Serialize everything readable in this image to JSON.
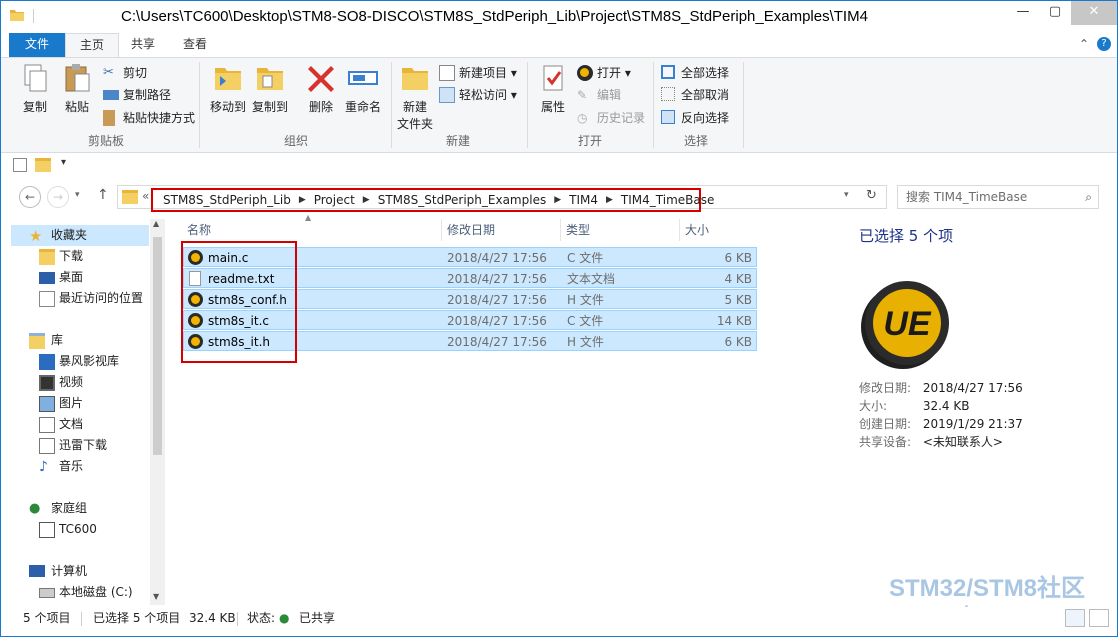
{
  "window": {
    "title": "C:\\Users\\TC600\\Desktop\\STM8-SO8-DISCO\\STM8S_StdPeriph_Lib\\Project\\STM8S_StdPeriph_Examples\\TIM4"
  },
  "ribbon_tabs": [
    "文件",
    "主页",
    "共享",
    "查看"
  ],
  "ribbon": {
    "clipboard": {
      "copy": "复制",
      "paste": "粘贴",
      "cut": "剪切",
      "copy_path": "复制路径",
      "paste_shortcut": "粘贴快捷方式",
      "label": "剪贴板"
    },
    "organize": {
      "move_to": "移动到",
      "copy_to": "复制到",
      "delete": "删除",
      "rename": "重命名",
      "label": "组织"
    },
    "new": {
      "new_folder_line1": "新建",
      "new_folder_line2": "文件夹",
      "new_item": "新建项目",
      "easy_access": "轻松访问",
      "label": "新建"
    },
    "open": {
      "properties": "属性",
      "open": "打开",
      "edit": "编辑",
      "history": "历史记录",
      "label": "打开"
    },
    "select": {
      "select_all": "全部选择",
      "select_none": "全部取消",
      "invert": "反向选择",
      "label": "选择"
    }
  },
  "address": {
    "overflow": "«",
    "crumbs": [
      "STM8S_StdPeriph_Lib",
      "Project",
      "STM8S_StdPeriph_Examples",
      "TIM4",
      "TIM4_TimeBase"
    ],
    "search_placeholder": "搜索 TIM4_TimeBase"
  },
  "nav": {
    "favorites": "收藏夹",
    "downloads": "下载",
    "desktop": "桌面",
    "recent": "最近访问的位置",
    "libraries": "库",
    "storm": "暴风影视库",
    "videos": "视频",
    "pictures": "图片",
    "documents": "文档",
    "thunder": "迅雷下载",
    "music": "音乐",
    "homegroup": "家庭组",
    "user": "TC600",
    "computer": "计算机",
    "local_disk": "本地磁盘 (C:)"
  },
  "columns": {
    "name": "名称",
    "date": "修改日期",
    "type": "类型",
    "size": "大小"
  },
  "files": [
    {
      "name": "main.c",
      "date": "2018/4/27 17:56",
      "type": "C 文件",
      "size": "6 KB",
      "icon": "ultraedit-icon"
    },
    {
      "name": "readme.txt",
      "date": "2018/4/27 17:56",
      "type": "文本文档",
      "size": "4 KB",
      "icon": "text-file-icon"
    },
    {
      "name": "stm8s_conf.h",
      "date": "2018/4/27 17:56",
      "type": "H 文件",
      "size": "5 KB",
      "icon": "ultraedit-icon"
    },
    {
      "name": "stm8s_it.c",
      "date": "2018/4/27 17:56",
      "type": "C 文件",
      "size": "14 KB",
      "icon": "ultraedit-icon"
    },
    {
      "name": "stm8s_it.h",
      "date": "2018/4/27 17:56",
      "type": "H 文件",
      "size": "6 KB",
      "icon": "ultraedit-icon"
    }
  ],
  "details": {
    "title": "已选择 5 个项",
    "modified_k": "修改日期:",
    "modified_v": "2018/4/27 17:56",
    "size_k": "大小:",
    "size_v": "32.4 KB",
    "created_k": "创建日期:",
    "created_v": "2019/1/29 21:37",
    "shared_k": "共享设备:",
    "shared_v": "<未知联系人>"
  },
  "status": {
    "count": "5 个项目",
    "selected": "已选择 5 个项目",
    "size": "32.4 KB",
    "state_label": "状态:",
    "state_value": "已共享"
  },
  "watermark": {
    "line1": "STM32/STM8社区",
    "line2": "www.stmcu.org.cn"
  },
  "colors": {
    "accent": "#1979ca",
    "selection": "#cce8ff",
    "highlight_box": "#d40000"
  }
}
